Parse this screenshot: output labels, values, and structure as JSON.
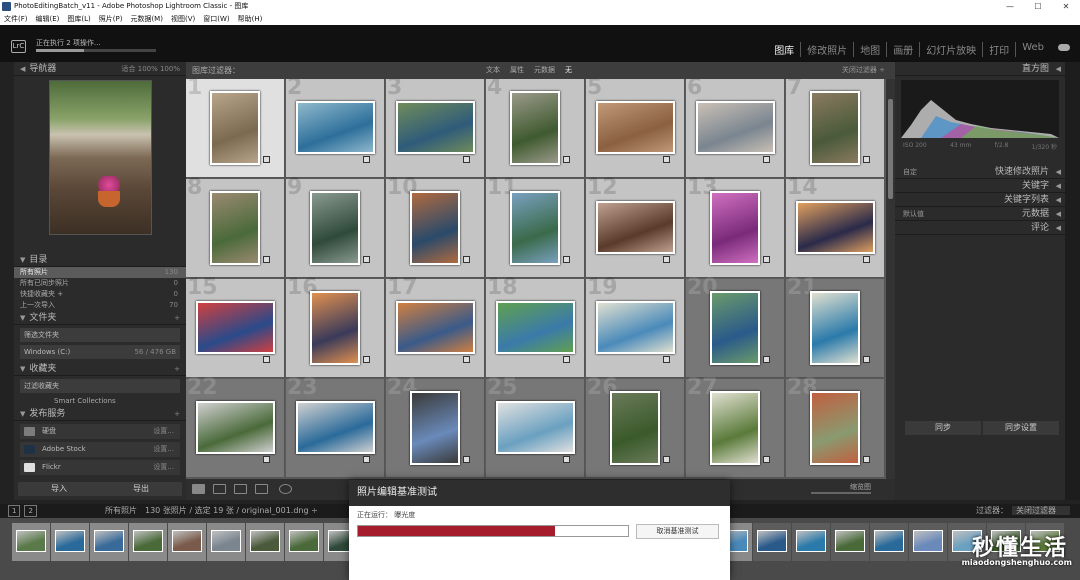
{
  "window": {
    "title": "PhotoEditingBatch_v11 - Adobe Photoshop Lightroom Classic - 图库",
    "controls": [
      "—",
      "☐",
      "✕"
    ]
  },
  "menu": [
    "文件(F)",
    "编辑(E)",
    "图库(L)",
    "照片(P)",
    "元数据(M)",
    "视图(V)",
    "窗口(W)",
    "帮助(H)"
  ],
  "identity": {
    "logo": "LrC",
    "task": "正在执行 2 项操作..."
  },
  "modules": [
    "图库",
    "修改照片",
    "地图",
    "画册",
    "幻灯片放映",
    "打印",
    "Web"
  ],
  "active_module": "图库",
  "navigator": {
    "title": "导航器",
    "options": "适合   100%   100%"
  },
  "catalog": {
    "title": "目录",
    "items": [
      {
        "label": "所有照片",
        "count": "130"
      },
      {
        "label": "所有已同步照片",
        "count": "0"
      },
      {
        "label": "快捷收藏夹 +",
        "count": "0"
      },
      {
        "label": "上一次导入",
        "count": "70"
      }
    ]
  },
  "folders": {
    "title": "文件夹",
    "find": "筛选文件夹",
    "volume": "Windows (C:)",
    "volume_size": "56 / 476 GB"
  },
  "collections": {
    "title": "收藏夹",
    "find": "过滤收藏夹",
    "smart": "Smart Collections"
  },
  "publish": {
    "title": "发布服务",
    "services": [
      {
        "label": "硬盘",
        "action": "设置...",
        "color": "#7c7c7c"
      },
      {
        "label": "Adobe Stock",
        "action": "设置...",
        "color": "#1f3245"
      },
      {
        "label": "Flickr",
        "action": "设置...",
        "color": "#e0e0e0"
      }
    ]
  },
  "left_buttons": {
    "import": "导入",
    "export": "导出"
  },
  "filter": {
    "title": "图库过滤器：",
    "options": [
      "文本",
      "属性",
      "元数据",
      "无"
    ],
    "preset": "关闭过滤器 ÷"
  },
  "grid_numbers": [
    "1",
    "2",
    "3",
    "4",
    "5",
    "6",
    "7",
    "8",
    "9",
    "10",
    "11",
    "12",
    "13",
    "14",
    "15",
    "16",
    "17",
    "18",
    "19",
    "20",
    "21",
    "22",
    "23",
    "24",
    "25",
    "26",
    "27",
    "28"
  ],
  "toolbar": {
    "thumbs": "缩览图"
  },
  "right": {
    "histogram": "直方图",
    "hist_info": [
      "ISO 200",
      "43 mm",
      "f/2.8",
      "1/320 秒"
    ],
    "quick_dev": "快速修改照片",
    "preset_label": "自定",
    "keywording": "关键字",
    "keyword_list": "关键字列表",
    "metadata": "元数据",
    "metadata_preset": "默认值",
    "comments": "评论"
  },
  "right_buttons": {
    "sync": "同步",
    "sync_settings": "同步设置"
  },
  "filmstrip": {
    "page1": "1",
    "page2": "2",
    "source": "所有照片",
    "count": "130 张照片 / 选定 19 张 / original_001.dng ÷",
    "filter_label": "过滤器：",
    "filter_value": "关闭过滤器"
  },
  "dialog": {
    "title": "照片编辑基准测试",
    "status": "正在运行： 曝光度",
    "progress": 0.73,
    "cancel": "取消基准测试"
  },
  "watermark": {
    "line1": "秒懂生活",
    "line2": "miaodongshenghuo.com"
  }
}
